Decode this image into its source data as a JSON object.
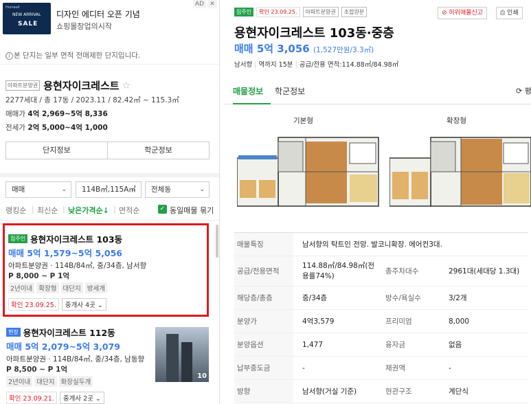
{
  "ad": {
    "thumb_brand": "Homeall",
    "thumb_event": "NEW ARRIVAL",
    "thumb_sale": "SALE",
    "title": "디자인 에디터 오픈 기념",
    "subtitle": "쇼핑몰창업의시작",
    "badge": "AD",
    "close": "✕"
  },
  "notice": {
    "icon": "i",
    "text": "본 단지는 일부 면적 전매제한 단지입니다."
  },
  "complex": {
    "tag": "아파트분양권",
    "name": "용현자이크레스트",
    "star": "☆",
    "summary": "2277세대 / 총 17동 / 2023.11 / 82.42㎡ ~ 115.3㎡",
    "sale_label": "매매가",
    "sale_value": "4억 2,969~5억 8,336",
    "jeonse_label": "전세가",
    "jeonse_value": "2억 5,000~4억 1,000",
    "btn_info": "단지정보",
    "btn_school": "학군정보"
  },
  "filters": {
    "trade": "매매",
    "area": "114B㎡,115A㎡",
    "dong": "전체동",
    "chevron": "⌄"
  },
  "sorts": {
    "ranking": "랭킹순",
    "newest": "최신순",
    "price_low": "낮은가격순↓",
    "area": "면적순",
    "sep": "|",
    "check": "✓",
    "group_label": "동일매물 묶기"
  },
  "listings": [
    {
      "tag": "집주인",
      "name": "용현자이크레스트 103동",
      "price": "매매 5억 1,579~5억 5,056",
      "desc": "아파트분양권 · 114B/84㎡, 중/34층, 남서향",
      "fee": "P 8,000 ~ P 1억",
      "chips": [
        "2년이내",
        "확장형",
        "대단지",
        "방세개"
      ],
      "confirm": "확인 23.09.25.",
      "agents": "중개사 4곳 ⌄"
    },
    {
      "tag": "현장",
      "name": "용현자이크레스트 112동",
      "price": "매매 5억 2,079~5억 3,079",
      "desc": "아파트분양권 · 114B/84㎡, 중/34층, 남동향",
      "fee": "P 8,500 ~ P 1억",
      "chips": [
        "2년이내",
        "대단지",
        "화장실두개"
      ],
      "confirm": "확인 23.09.21.",
      "agents": "중개사 2곳 ⌄",
      "photo_count": "10"
    }
  ],
  "detail": {
    "tags": [
      "집주인",
      "확인 23.09.25.",
      "아파트분양권",
      "조합원분"
    ],
    "report": "⊘ 허위매물신고",
    "print": "⎙ 인쇄",
    "title": "용현자이크레스트 103동·중층",
    "price": "매매 5억 3,056",
    "price_unit": "(1,527만원/3.3㎡)",
    "meta": [
      "남서향",
      "역까지 15분",
      "공급/전용 면적:114.88㎡/84.98㎡"
    ],
    "tab_listing": "매물정보",
    "tab_school": "학군정보",
    "refresh": "⟳ 평",
    "plan_basic": "기본형",
    "plan_ext": "확장형",
    "rows": [
      {
        "k": "매물특징",
        "v": "남서향의 탁트인 전망. 발코니확장. 에어컨3대."
      },
      {
        "k": "공급/전용면적",
        "v": "114.88㎡/84.98㎡(전용률74%)",
        "k2": "총주차대수",
        "v2": "2961대(세대당 1.3대)"
      },
      {
        "k": "해당층/총층",
        "v": "중/34층",
        "k2": "방수/욕실수",
        "v2": "3/2개"
      },
      {
        "k": "분양가",
        "v": "4억3,579",
        "k2": "프리미엄",
        "v2": "8,000"
      },
      {
        "k": "분양옵션",
        "v": "1,477",
        "k2": "융자금",
        "v2": "없음"
      },
      {
        "k": "납부중도금",
        "v": "-",
        "k2": "채권액",
        "v2": "-"
      },
      {
        "k": "방향",
        "v": "남서향(거실 기준)",
        "k2": "현관구조",
        "v2": "계단식"
      }
    ]
  },
  "colors": {
    "accent_green": "#23a047",
    "price_blue": "#3b7be8",
    "highlight_red": "#e0191e"
  }
}
